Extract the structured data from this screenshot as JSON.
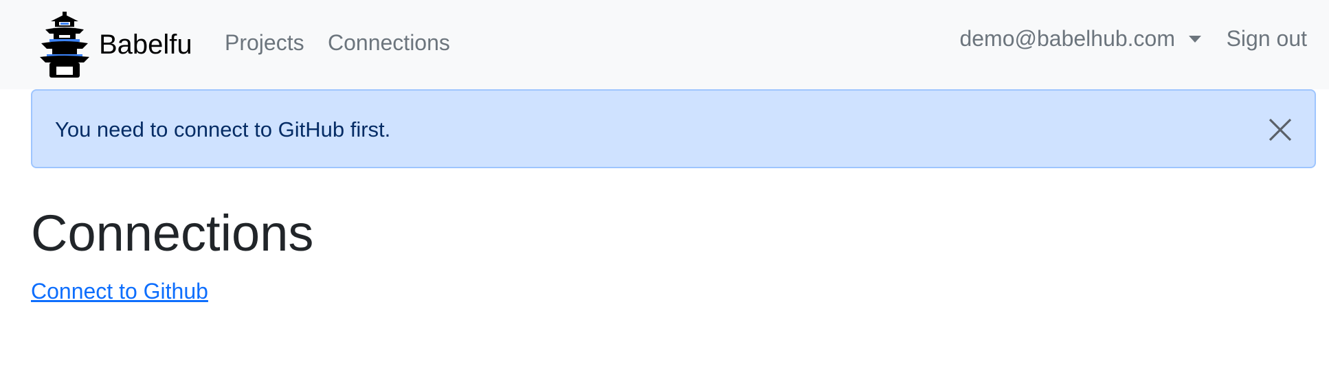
{
  "navbar": {
    "brand": {
      "name": "Babelfu",
      "logo_icon": "pagoda-icon"
    },
    "links": [
      {
        "label": "Projects"
      },
      {
        "label": "Connections"
      }
    ],
    "user": {
      "email": "demo@babelhub.com",
      "dropdown_icon": "caret-down-icon"
    },
    "sign_out_label": "Sign out"
  },
  "alert": {
    "message": "You need to connect to GitHub first.",
    "close_icon": "close-icon",
    "colors": {
      "background": "#cfe2ff",
      "border": "#9ec5fe",
      "text": "#052c65"
    }
  },
  "main": {
    "title": "Connections",
    "connect_link_label": "Connect to Github",
    "link_color": "#0d6efd"
  }
}
